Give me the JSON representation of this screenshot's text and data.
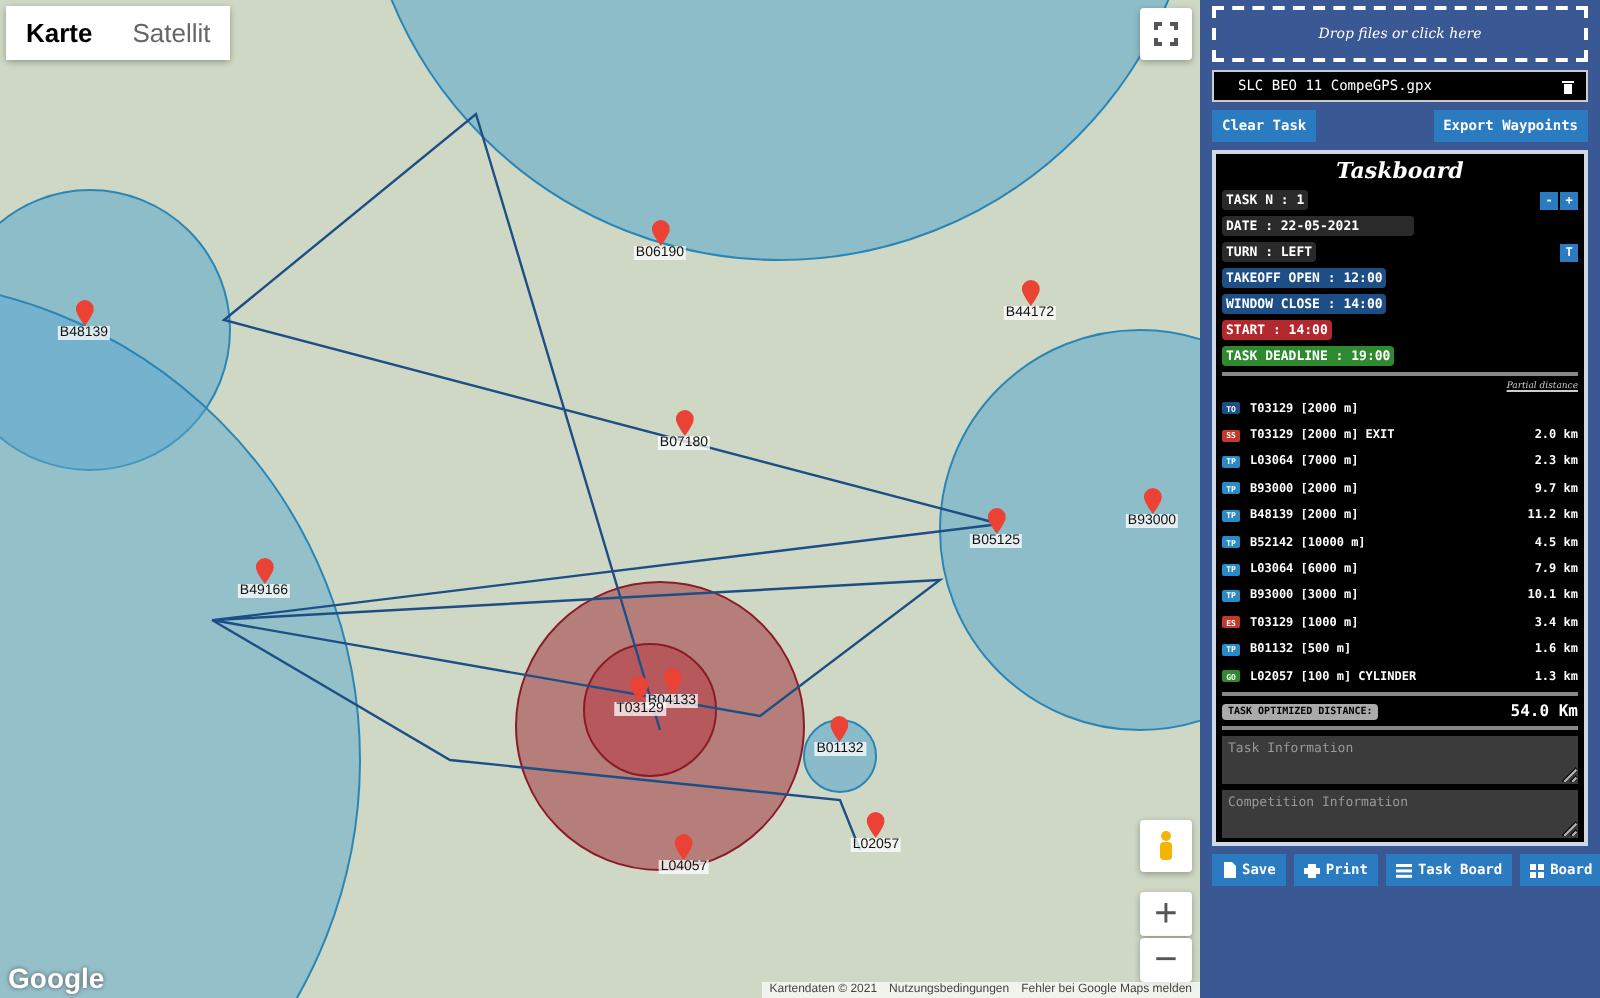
{
  "map": {
    "map_types": [
      {
        "label": "Karte",
        "selected": true
      },
      {
        "label": "Satellit",
        "selected": false
      }
    ],
    "markers": [
      {
        "label": "B48139"
      },
      {
        "label": "B06190"
      },
      {
        "label": "B44172"
      },
      {
        "label": "B07180"
      },
      {
        "label": "B93000"
      },
      {
        "label": "B05125"
      },
      {
        "label": "B49166"
      },
      {
        "label": "B04133"
      },
      {
        "label": "T03129"
      },
      {
        "label": "B01132"
      },
      {
        "label": "L02057"
      },
      {
        "label": "L04057"
      }
    ],
    "zoom_in": "+",
    "zoom_out": "−",
    "logo": "Google",
    "attribution": [
      "Kartendaten © 2021",
      "Nutzungsbedingungen",
      "Fehler bei Google Maps melden"
    ]
  },
  "panel": {
    "drop_zone": "Drop files or click here",
    "file_name": "SLC BEO 11 CompeGPS.gpx",
    "buttons_top": [
      "Clear Task",
      "Export Waypoints"
    ],
    "taskboard": {
      "title": "Taskboard",
      "fields": [
        {
          "label": "TASK N : 1",
          "color": "#2a2a2a",
          "wide": false
        },
        {
          "label": "DATE : 22-05-2021",
          "color": "#2a2a2a",
          "wide": true
        },
        {
          "label": "TURN : LEFT",
          "color": "#2a2a2a",
          "wide": false
        },
        {
          "label": "TAKEOFF OPEN : 12:00",
          "color": "#1d4f86",
          "wide": false
        },
        {
          "label": "WINDOW CLOSE : 14:00",
          "color": "#1d4f86",
          "wide": false
        },
        {
          "label": "START : 14:00",
          "color": "#b3282d",
          "wide": false
        },
        {
          "label": "TASK DEADLINE : 19:00",
          "color": "#2f8a2f",
          "wide": false
        }
      ],
      "task_buttons": [
        "-",
        "+"
      ],
      "turn_button": "T",
      "partial_heading": "Partial distance",
      "waypoints": [
        {
          "type": "TO",
          "color": "#1d4f86",
          "name": "T03129 [2000 m]"
        },
        {
          "type": "SS",
          "color": "#c0392b",
          "name": "T03129 [2000 m] EXIT",
          "distance": "2.0 km"
        },
        {
          "type": "TP",
          "color": "#2a8ac6",
          "name": "L03064 [7000 m]",
          "distance": "2.3 km"
        },
        {
          "type": "TP",
          "color": "#2a8ac6",
          "name": "B93000 [2000 m]",
          "distance": "9.7 km"
        },
        {
          "type": "TP",
          "color": "#2a8ac6",
          "name": "B48139 [2000 m]",
          "distance": "11.2 km"
        },
        {
          "type": "TP",
          "color": "#2a8ac6",
          "name": "B52142 [10000 m]",
          "distance": "4.5 km"
        },
        {
          "type": "TP",
          "color": "#2a8ac6",
          "name": "L03064 [6000 m]",
          "distance": "7.9 km"
        },
        {
          "type": "TP",
          "color": "#2a8ac6",
          "name": "B93000 [3000 m]",
          "distance": "10.1 km"
        },
        {
          "type": "ES",
          "color": "#c0392b",
          "name": "T03129 [1000 m]",
          "distance": "3.4 km"
        },
        {
          "type": "TP",
          "color": "#2a8ac6",
          "name": "B01132 [500 m]",
          "distance": "1.6 km"
        },
        {
          "type": "GO",
          "color": "#2f8a2f",
          "name": "L02057 [100 m] CYLINDER",
          "distance": "1.3 km"
        }
      ],
      "total_label": "TASK OPTIMIZED DISTANCE:",
      "total": "54.0 Km",
      "task_info_placeholder": "Task Information",
      "competition_info_placeholder": "Competition Information"
    },
    "buttons_bottom": [
      {
        "kind": "save",
        "label": "Save"
      },
      {
        "kind": "print",
        "label": "Print"
      },
      {
        "kind": "list",
        "label": "Task Board"
      },
      {
        "kind": "grid",
        "label": "Board"
      }
    ]
  }
}
